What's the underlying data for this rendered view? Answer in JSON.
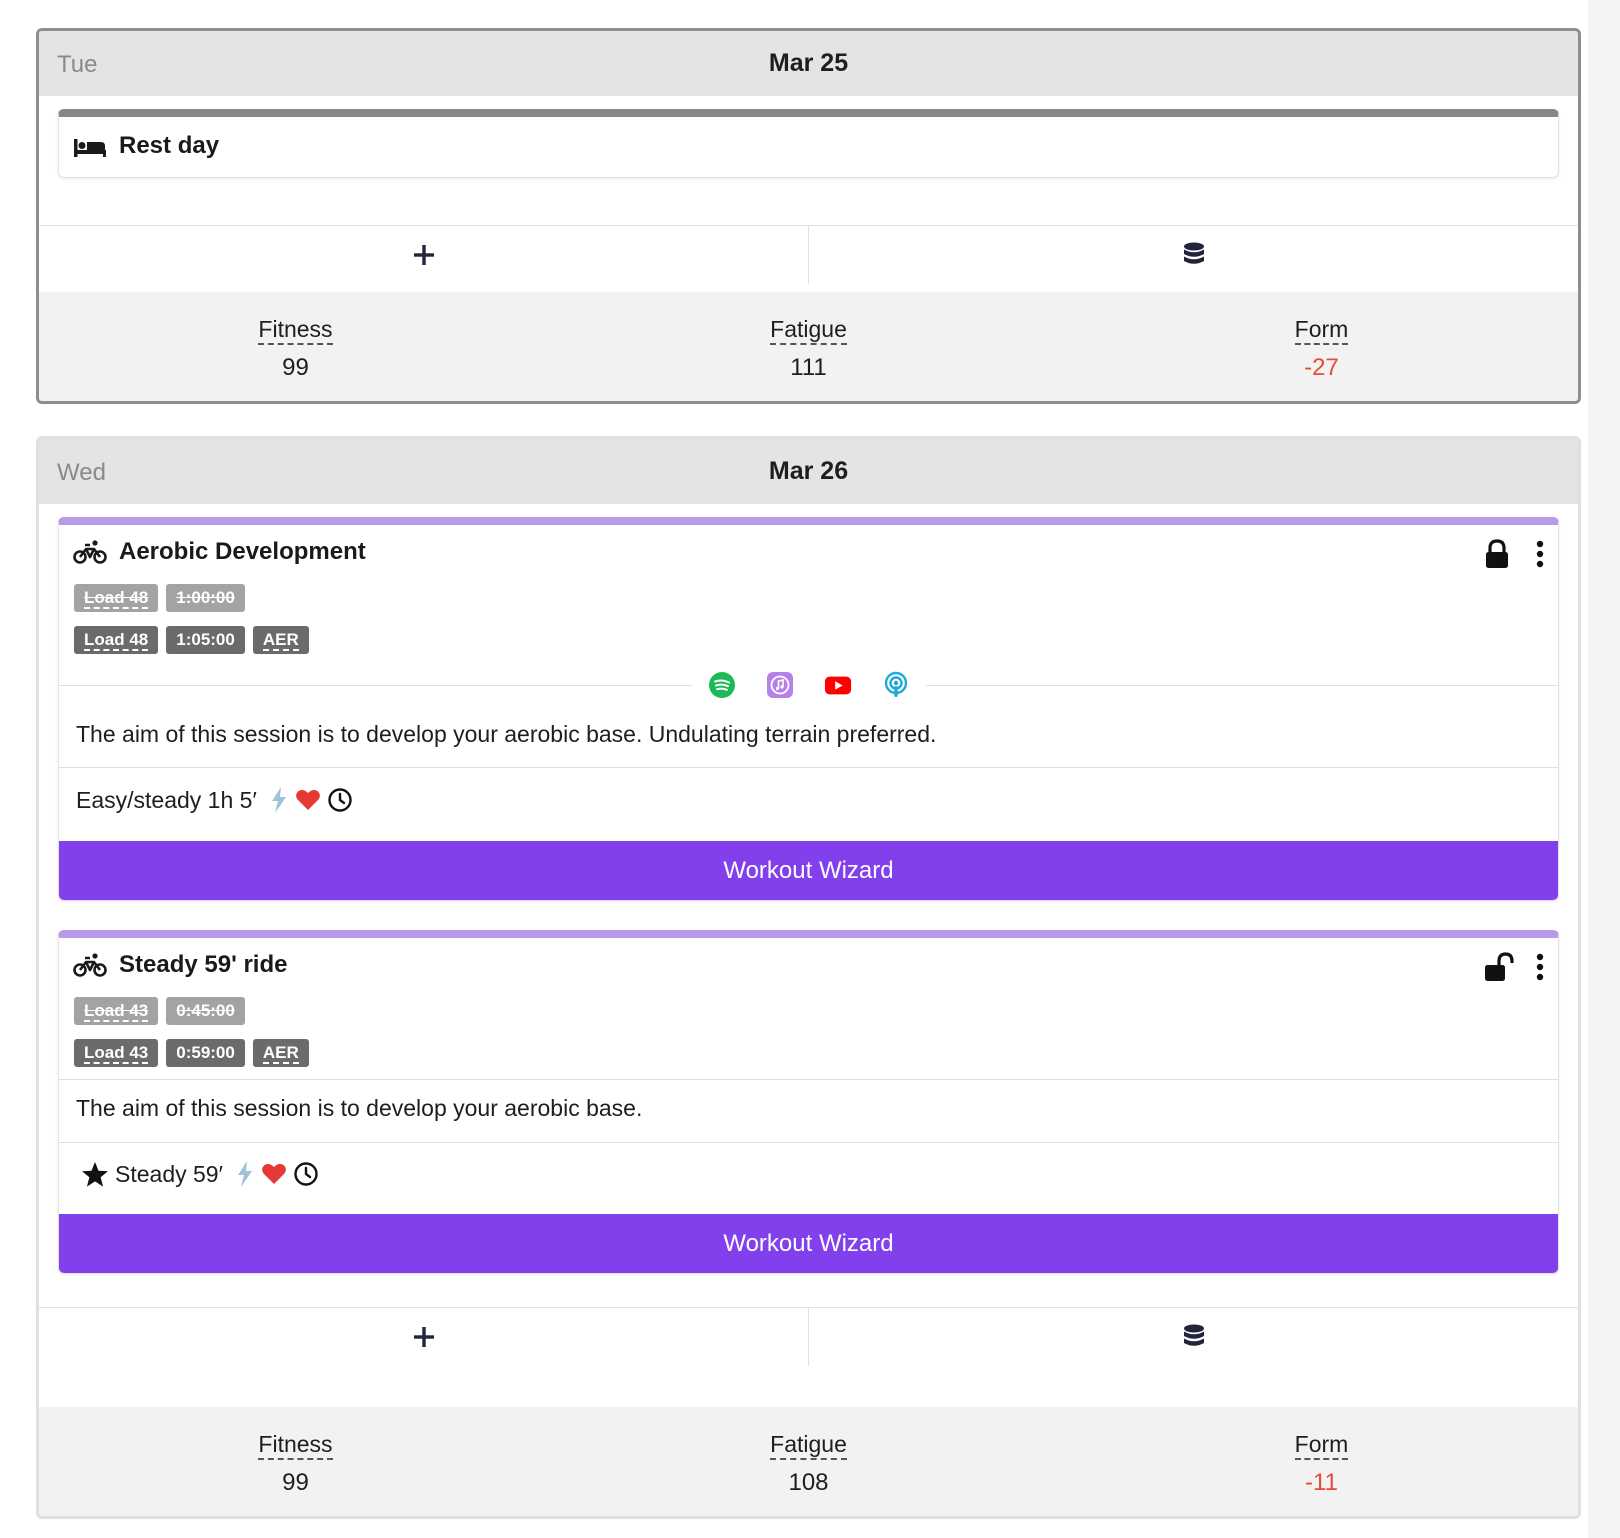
{
  "colors": {
    "accent": "#8240ec",
    "negative": "#e84a3a",
    "workout_bar": "#b99ae6",
    "rest_bar": "#878787"
  },
  "days": [
    {
      "weekday": "Tue",
      "date": "Mar 25",
      "rest": {
        "title": "Rest day",
        "icon": "bed-icon"
      },
      "actions": {
        "add_icon": "plus-icon",
        "library_icon": "database-icon"
      },
      "stats": {
        "fitness_label": "Fitness",
        "fitness_value": "99",
        "fatigue_label": "Fatigue",
        "fatigue_value": "111",
        "form_label": "Form",
        "form_value": "-27"
      }
    },
    {
      "weekday": "Wed",
      "date": "Mar 26",
      "workouts": [
        {
          "title": "Aerobic Development",
          "icon": "bike-icon",
          "lock": "locked",
          "planned_load": "Load 48",
          "planned_duration": "1:00:00",
          "load": "Load 48",
          "duration": "1:05:00",
          "zone": "AER",
          "media": [
            "spotify-icon",
            "apple-music-icon",
            "youtube-icon",
            "podcast-icon"
          ],
          "description": "The aim of this session is to develop your aerobic base. Undulating terrain preferred.",
          "steps": "Easy/steady 1h 5′",
          "button": "Workout Wizard"
        },
        {
          "title": "Steady 59' ride",
          "icon": "bike-icon",
          "lock": "unlocked",
          "planned_load": "Load 43",
          "planned_duration": "0:45:00",
          "load": "Load 43",
          "duration": "0:59:00",
          "zone": "AER",
          "description": "The aim of this session is to develop your aerobic base.",
          "steps": "Steady 59′",
          "button": "Workout Wizard"
        }
      ],
      "actions": {
        "add_icon": "plus-icon",
        "library_icon": "database-icon"
      },
      "stats": {
        "fitness_label": "Fitness",
        "fitness_value": "99",
        "fatigue_label": "Fatigue",
        "fatigue_value": "108",
        "form_label": "Form",
        "form_value": "-11"
      }
    }
  ]
}
